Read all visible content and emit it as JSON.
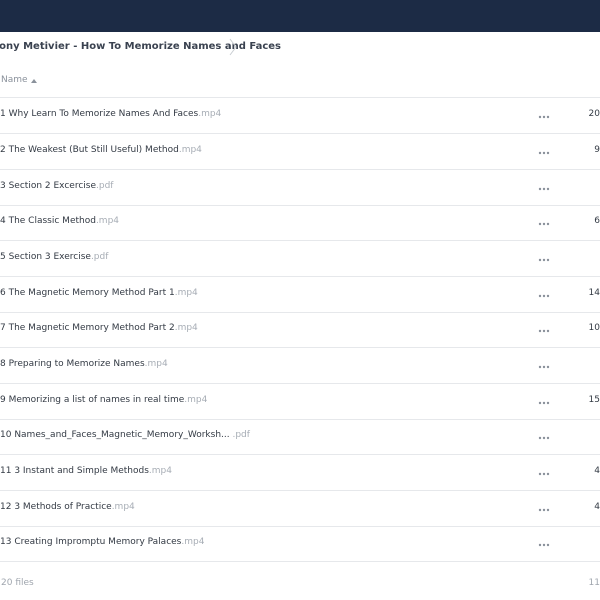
{
  "breadcrumb": {
    "title": "hony Metivier - How To Memorize Names and Faces"
  },
  "list_header": {
    "name_label": "Name",
    "sort_icon": "sort-ascending-icon"
  },
  "files": [
    {
      "name": "1 Why Learn To Memorize Names And Faces",
      "ext": ".mp4",
      "size": "20"
    },
    {
      "name": "2 The Weakest (But Still Useful) Method",
      "ext": ".mp4",
      "size": "9"
    },
    {
      "name": "3 Section 2 Excercise",
      "ext": ".pdf",
      "size": ""
    },
    {
      "name": "4 The Classic Method",
      "ext": ".mp4",
      "size": "6"
    },
    {
      "name": "5 Section 3 Exercise",
      "ext": ".pdf",
      "size": ""
    },
    {
      "name": "6 The Magnetic Memory Method Part 1",
      "ext": ".mp4",
      "size": "14"
    },
    {
      "name": "7 The Magnetic Memory Method Part 2",
      "ext": ".mp4",
      "size": "10"
    },
    {
      "name": "8 Preparing to Memorize Names",
      "ext": ".mp4",
      "size": ""
    },
    {
      "name": "9 Memorizing a list of names in real time",
      "ext": ".mp4",
      "size": "15"
    },
    {
      "name": "10 Names_and_Faces_Magnetic_Memory_Worksh...",
      "ext": " .pdf",
      "size": ""
    },
    {
      "name": "11 3 Instant and Simple Methods",
      "ext": ".mp4",
      "size": "4"
    },
    {
      "name": "12 3 Methods of Practice",
      "ext": ".mp4",
      "size": "4"
    },
    {
      "name": "13 Creating Impromptu Memory Palaces",
      "ext": ".mp4",
      "size": ""
    }
  ],
  "footer": {
    "file_count": "20 files",
    "total_size": "11"
  },
  "colors": {
    "topbar": "#1c2b45",
    "extension": "#a7adb5",
    "text": "#333a44",
    "divider": "#e6e8eb"
  }
}
